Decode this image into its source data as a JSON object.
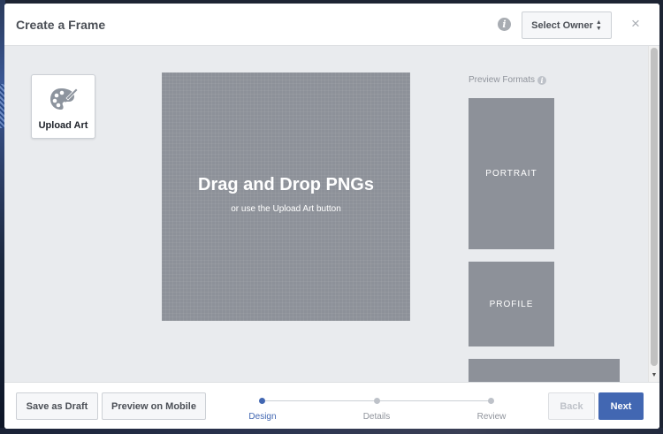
{
  "header": {
    "title": "Create a Frame",
    "owner_button": "Select Owner"
  },
  "canvas": {
    "upload_art_label": "Upload Art",
    "drop_title": "Drag and Drop PNGs",
    "drop_subtitle": "or use the Upload Art button"
  },
  "preview": {
    "label": "Preview Formats",
    "formats": [
      "PORTRAIT",
      "PROFILE"
    ]
  },
  "footer": {
    "save_draft": "Save as Draft",
    "preview_mobile": "Preview on Mobile",
    "back": "Back",
    "next": "Next",
    "steps": [
      {
        "label": "Design",
        "active": true
      },
      {
        "label": "Details",
        "active": false
      },
      {
        "label": "Review",
        "active": false
      }
    ]
  },
  "icons": {
    "info": "info-icon",
    "close": "close-icon",
    "palette": "palette-icon",
    "sort_caret": "sort-caret-icon"
  },
  "colors": {
    "accent": "#4267b2",
    "placeholder_gray": "#8d9199",
    "canvas_bg": "#e9ebee"
  }
}
